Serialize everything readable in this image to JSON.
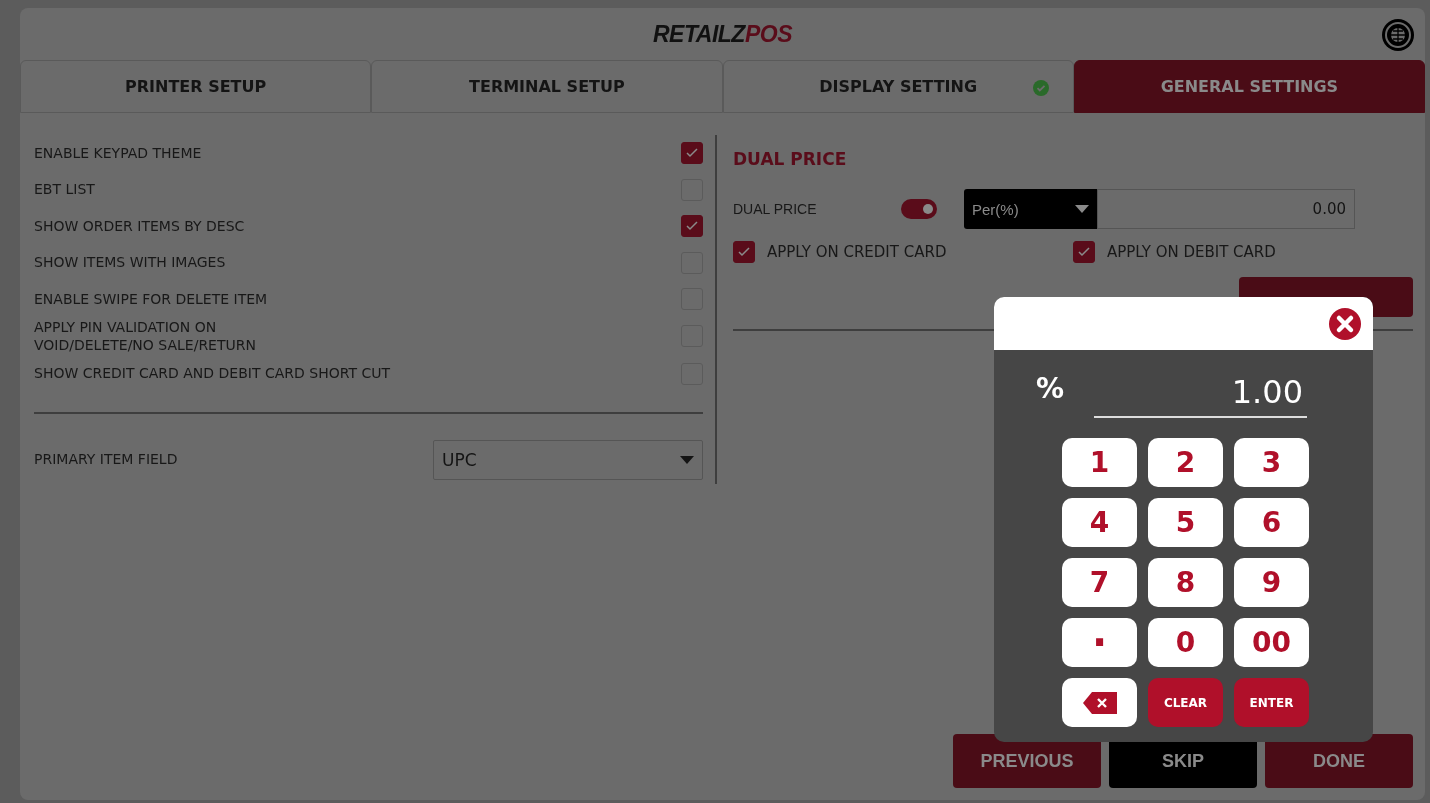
{
  "header": {
    "brand": "RETAILZ",
    "accent": "POS"
  },
  "tabs": [
    {
      "label": "PRINTER SETUP",
      "selected": false,
      "verified": false
    },
    {
      "label": "TERMINAL SETUP",
      "selected": false,
      "verified": false
    },
    {
      "label": "DISPLAY SETTING",
      "selected": false,
      "verified": true
    },
    {
      "label": "GENERAL SETTINGS",
      "selected": true,
      "verified": false
    }
  ],
  "settings": [
    {
      "label": "ENABLE KEYPAD THEME",
      "checked": true
    },
    {
      "label": "EBT LIST",
      "checked": false
    },
    {
      "label": "SHOW ORDER ITEMS BY DESC",
      "checked": true
    },
    {
      "label": "SHOW ITEMS WITH IMAGES",
      "checked": false
    },
    {
      "label": "ENABLE SWIPE FOR DELETE ITEM",
      "checked": false
    },
    {
      "label": "APPLY PIN VALIDATION ON\nVOID/DELETE/NO SALE/RETURN",
      "checked": false
    },
    {
      "label": "SHOW CREDIT CARD AND DEBIT CARD SHORT CUT",
      "checked": false
    }
  ],
  "primary_item_field": {
    "label": "PRIMARY ITEM FIELD",
    "value": "UPC"
  },
  "dual_price": {
    "title": "DUAL PRICE",
    "label": "DUAL PRICE",
    "on": true,
    "mode": "Per(%)",
    "amount": "0.00",
    "options": [
      {
        "label": "APPLY ON CREDIT CARD",
        "checked": true
      },
      {
        "label": "APPLY ON DEBIT CARD",
        "checked": true
      }
    ]
  },
  "keypad": {
    "symbol": "%",
    "value": "1.00",
    "keys": [
      {
        "label": "1",
        "kind": "digit"
      },
      {
        "label": "2",
        "kind": "digit"
      },
      {
        "label": "3",
        "kind": "digit"
      },
      {
        "label": "4",
        "kind": "digit"
      },
      {
        "label": "5",
        "kind": "digit"
      },
      {
        "label": "6",
        "kind": "digit"
      },
      {
        "label": "7",
        "kind": "digit"
      },
      {
        "label": "8",
        "kind": "digit"
      },
      {
        "label": "9",
        "kind": "digit"
      },
      {
        "label": ".",
        "kind": "decimal"
      },
      {
        "label": "0",
        "kind": "digit"
      },
      {
        "label": "00",
        "kind": "digit"
      },
      {
        "kind": "backspace"
      },
      {
        "label": "CLEAR",
        "kind": "action"
      },
      {
        "label": "ENTER",
        "kind": "action"
      }
    ]
  },
  "footer_buttons": [
    {
      "label": "PREVIOUS",
      "kind": "accent"
    },
    {
      "label": "SKIP",
      "kind": "dark"
    },
    {
      "label": "DONE",
      "kind": "accent"
    }
  ]
}
